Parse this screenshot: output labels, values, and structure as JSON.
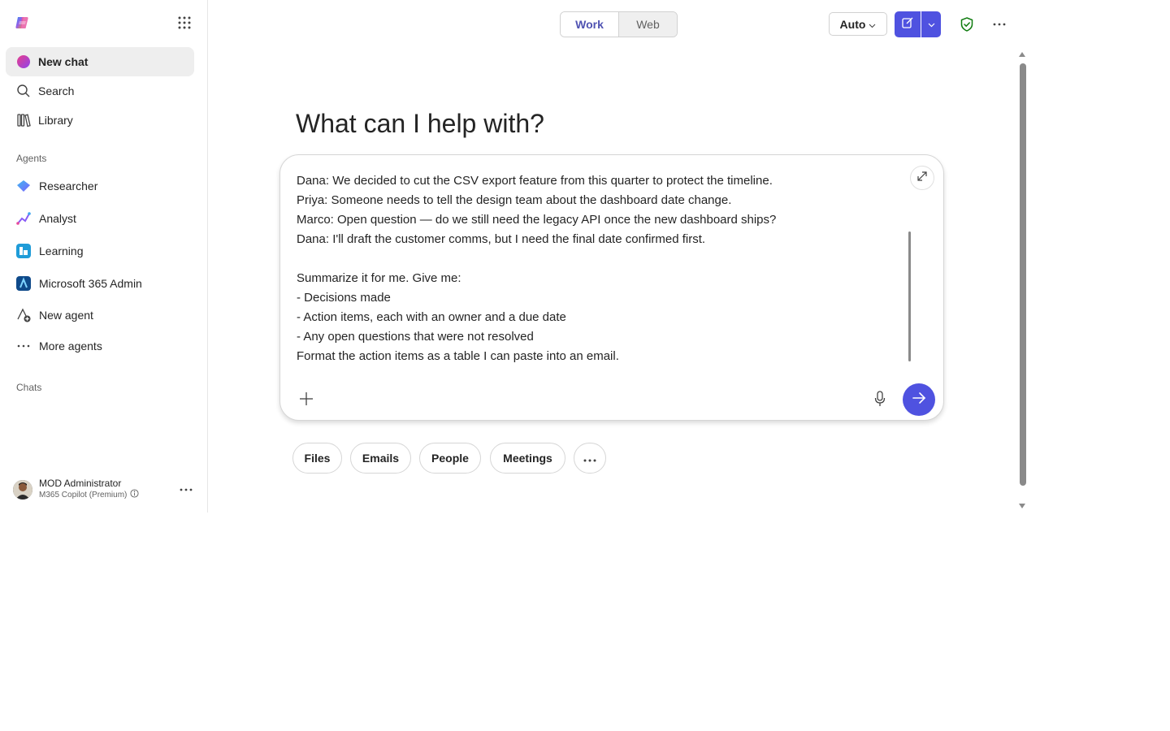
{
  "sidebar": {
    "primary": [
      {
        "label": "New chat",
        "icon": "copilot-chat-icon"
      },
      {
        "label": "Search",
        "icon": "search-icon"
      },
      {
        "label": "Library",
        "icon": "library-icon"
      }
    ],
    "agents_label": "Agents",
    "agents": [
      {
        "label": "Researcher",
        "icon": "researcher-icon"
      },
      {
        "label": "Analyst",
        "icon": "analyst-icon"
      },
      {
        "label": "Learning",
        "icon": "learning-icon"
      },
      {
        "label": "Microsoft 365 Admin",
        "icon": "m365-admin-icon"
      },
      {
        "label": "New agent",
        "icon": "new-agent-icon"
      },
      {
        "label": "More agents",
        "icon": "more-icon"
      }
    ],
    "chats_label": "Chats",
    "user": {
      "name": "MOD Administrator",
      "plan": "M365 Copilot (Premium)"
    }
  },
  "topbar": {
    "toggle": {
      "work": "Work",
      "web": "Web",
      "selected": "Work"
    },
    "model": "Auto",
    "accent": "#4f52e0"
  },
  "main": {
    "heading": "What can I help with?",
    "prompt_text": "Dana: We decided to cut the CSV export feature from this quarter to protect the timeline.\nPriya: Someone needs to tell the design team about the dashboard date change.\nMarco: Open question — do we still need the legacy API once the new dashboard ships?\nDana: I'll draft the customer comms, but I need the final date confirmed first.\n\nSummarize it for me. Give me:\n- Decisions made\n- Action items, each with an owner and a due date\n- Any open questions that were not resolved\nFormat the action items as a table I can paste into an email.",
    "chips": [
      "Files",
      "Emails",
      "People",
      "Meetings"
    ]
  }
}
